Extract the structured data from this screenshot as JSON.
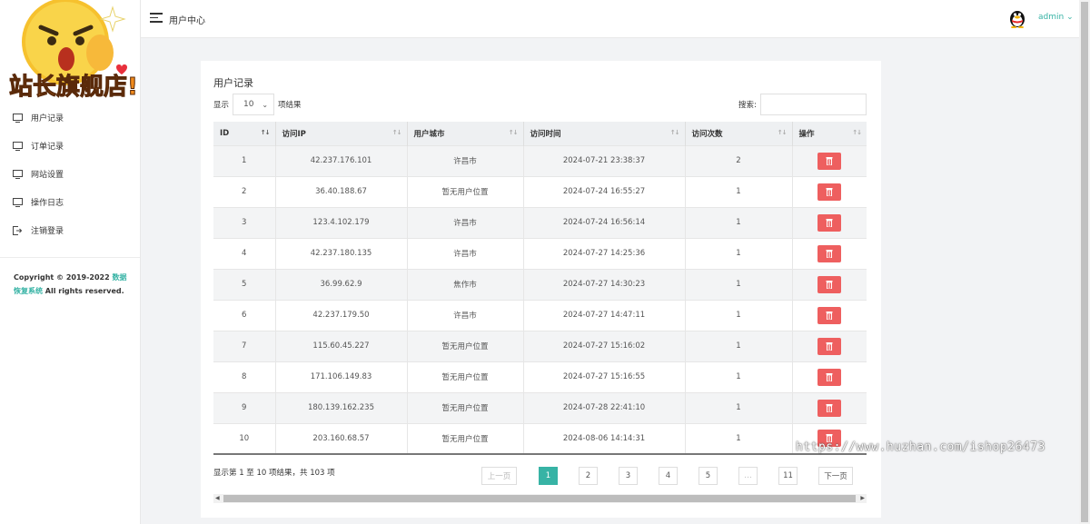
{
  "logo": {
    "text": "站长旗舰店!"
  },
  "sidebar": {
    "items": [
      {
        "label": "用户记录",
        "icon": "monitor-icon"
      },
      {
        "label": "订单记录",
        "icon": "monitor-icon"
      },
      {
        "label": "网站设置",
        "icon": "monitor-icon"
      },
      {
        "label": "操作日志",
        "icon": "monitor-icon"
      },
      {
        "label": "注销登录",
        "icon": "logout-icon"
      }
    ],
    "copyright_prefix": "Copyright © 2019-2022 ",
    "copyright_link": "数据恢复系统",
    "copyright_suffix": " All rights reserved."
  },
  "header": {
    "title": "用户中心",
    "user": "admin"
  },
  "panel": {
    "title": "用户记录",
    "length_prefix": "显示",
    "length_value": "10",
    "length_suffix": "项结果",
    "search_label": "搜索:",
    "search_value": ""
  },
  "table": {
    "columns": [
      "ID",
      "访问IP",
      "用户城市",
      "访问时间",
      "访问次数",
      "操作"
    ],
    "rows": [
      [
        "1",
        "42.237.176.101",
        "许昌市",
        "2024-07-21 23:38:37",
        "2"
      ],
      [
        "2",
        "36.40.188.67",
        "暂无用户位置",
        "2024-07-24 16:55:27",
        "1"
      ],
      [
        "3",
        "123.4.102.179",
        "许昌市",
        "2024-07-24 16:56:14",
        "1"
      ],
      [
        "4",
        "42.237.180.135",
        "许昌市",
        "2024-07-27 14:25:36",
        "1"
      ],
      [
        "5",
        "36.99.62.9",
        "焦作市",
        "2024-07-27 14:30:23",
        "1"
      ],
      [
        "6",
        "42.237.179.50",
        "许昌市",
        "2024-07-27 14:47:11",
        "1"
      ],
      [
        "7",
        "115.60.45.227",
        "暂无用户位置",
        "2024-07-27 15:16:02",
        "1"
      ],
      [
        "8",
        "171.106.149.83",
        "暂无用户位置",
        "2024-07-27 15:16:55",
        "1"
      ],
      [
        "9",
        "180.139.162.235",
        "暂无用户位置",
        "2024-07-28 22:41:10",
        "1"
      ],
      [
        "10",
        "203.160.68.57",
        "暂无用户位置",
        "2024-08-06 14:14:31",
        "1"
      ]
    ]
  },
  "footer": {
    "info": "显示第 1 至 10 项结果，共 103 项",
    "prev": "上一页",
    "pages": [
      "1",
      "2",
      "3",
      "4",
      "5",
      "…",
      "11"
    ],
    "next": "下一页"
  },
  "watermark": "https://www.huzhan.com/ishop26473",
  "colors": {
    "accent": "#37b3a5",
    "danger": "#ee5f5f"
  }
}
